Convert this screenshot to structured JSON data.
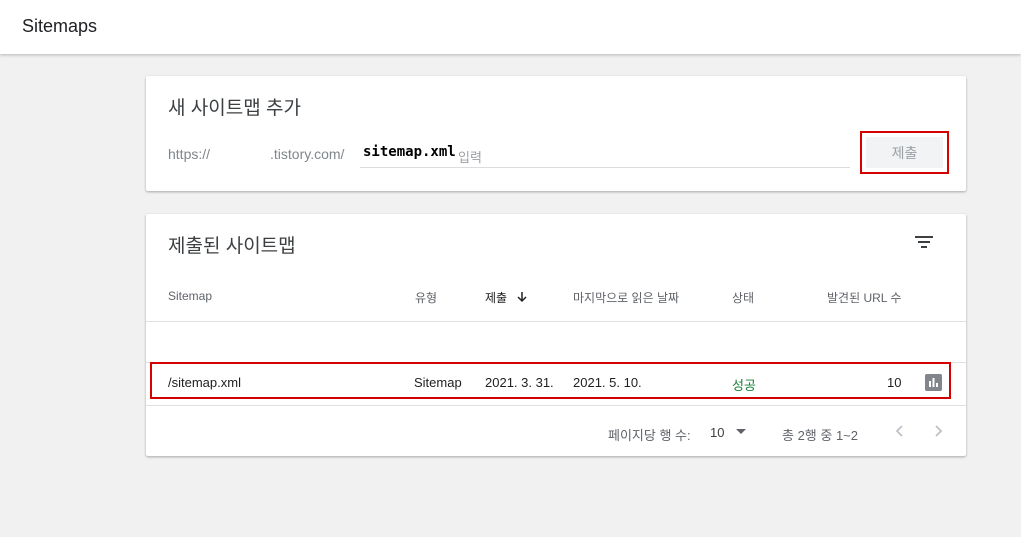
{
  "app": {
    "title": "Sitemaps"
  },
  "add_card": {
    "title": "새 사이트맵 추가",
    "url_prefix": "https://",
    "url_domain": ".tistory.com/",
    "input_value": "sitemap.xml",
    "input_placeholder": "입력",
    "submit_label": "제출"
  },
  "submitted_card": {
    "title": "제출된 사이트맵",
    "columns": [
      "Sitemap",
      "유형",
      "제출",
      "마지막으로 읽은 날짜",
      "상태",
      "발견된 URL 수"
    ],
    "rows": [
      {
        "sitemap": "/sitemap.xml",
        "type": "Sitemap",
        "submitted": "2021. 3. 31.",
        "last_read": "2021. 5. 10.",
        "status": "성공",
        "url_count": "10"
      }
    ],
    "pagination": {
      "rows_per_page_label": "페이지당 행 수:",
      "rows_per_page": "10",
      "range_label": "총 2행 중 1~2"
    }
  },
  "colors": {
    "highlight": "#d50000",
    "success": "#188038"
  }
}
